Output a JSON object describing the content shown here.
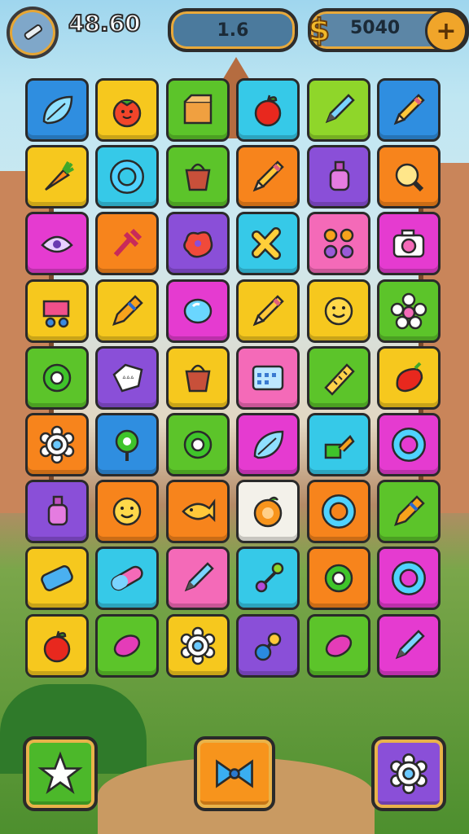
{
  "hud": {
    "score": "48.60",
    "level": "1.6",
    "coins": "5040",
    "coin_symbol": "$",
    "plus_label": "+"
  },
  "colors": {
    "blue": "#2f8ee0",
    "yellow": "#f6c81e",
    "green": "#5cc42a",
    "cyan": "#36c9e8",
    "lime": "#8fd62a",
    "orange": "#f7841c",
    "purple": "#8a4fd8",
    "magenta": "#e53bd0",
    "pink": "#f46ab8",
    "white": "#f3f1ea"
  },
  "board": {
    "rows": [
      [
        {
          "c": "blue",
          "i": "leaf-icon"
        },
        {
          "c": "yellow",
          "i": "tomato-icon"
        },
        {
          "c": "green",
          "i": "box-icon"
        },
        {
          "c": "cyan",
          "i": "apple-icon"
        },
        {
          "c": "lime",
          "i": "pen-icon"
        },
        {
          "c": "blue",
          "i": "pencil-icon"
        }
      ],
      [
        {
          "c": "yellow",
          "i": "carrot-icon"
        },
        {
          "c": "cyan",
          "i": "ring-icon"
        },
        {
          "c": "green",
          "i": "bag-icon"
        },
        {
          "c": "orange",
          "i": "pencil-icon"
        },
        {
          "c": "purple",
          "i": "bottle-icon"
        },
        {
          "c": "orange",
          "i": "magnifier-icon"
        }
      ],
      [
        {
          "c": "magenta",
          "i": "eye-icon"
        },
        {
          "c": "orange",
          "i": "tool-icon"
        },
        {
          "c": "purple",
          "i": "blob-icon"
        },
        {
          "c": "cyan",
          "i": "cross-icon"
        },
        {
          "c": "pink",
          "i": "scissors-icon"
        },
        {
          "c": "magenta",
          "i": "camera-icon"
        }
      ],
      [
        {
          "c": "yellow",
          "i": "cart-icon"
        },
        {
          "c": "yellow",
          "i": "crayon-icon"
        },
        {
          "c": "magenta",
          "i": "balloon-icon"
        },
        {
          "c": "yellow",
          "i": "pencil-icon"
        },
        {
          "c": "yellow",
          "i": "smiley-icon"
        },
        {
          "c": "green",
          "i": "flower-icon"
        }
      ],
      [
        {
          "c": "green",
          "i": "donut-icon"
        },
        {
          "c": "purple",
          "i": "tag-icon"
        },
        {
          "c": "yellow",
          "i": "bag-icon"
        },
        {
          "c": "pink",
          "i": "calculator-icon"
        },
        {
          "c": "green",
          "i": "ruler-icon"
        },
        {
          "c": "yellow",
          "i": "pepper-icon"
        }
      ],
      [
        {
          "c": "orange",
          "i": "gear-icon"
        },
        {
          "c": "blue",
          "i": "lollipop-icon"
        },
        {
          "c": "green",
          "i": "donut-icon"
        },
        {
          "c": "magenta",
          "i": "leaf-icon"
        },
        {
          "c": "cyan",
          "i": "cup-icon"
        },
        {
          "c": "magenta",
          "i": "ring-icon"
        }
      ],
      [
        {
          "c": "purple",
          "i": "bottle-icon"
        },
        {
          "c": "orange",
          "i": "smiley-icon"
        },
        {
          "c": "orange",
          "i": "fish-icon"
        },
        {
          "c": "white",
          "i": "orange-fruit-icon"
        },
        {
          "c": "orange",
          "i": "ring-icon"
        },
        {
          "c": "green",
          "i": "crayon-icon"
        }
      ],
      [
        {
          "c": "yellow",
          "i": "eraser-icon"
        },
        {
          "c": "cyan",
          "i": "pill-icon"
        },
        {
          "c": "pink",
          "i": "pen-icon"
        },
        {
          "c": "cyan",
          "i": "rattle-icon"
        },
        {
          "c": "orange",
          "i": "donut-icon"
        },
        {
          "c": "magenta",
          "i": "ring-icon"
        }
      ],
      [
        {
          "c": "yellow",
          "i": "apple-icon"
        },
        {
          "c": "green",
          "i": "candy-icon"
        },
        {
          "c": "yellow",
          "i": "gear-icon"
        },
        {
          "c": "purple",
          "i": "pacifier-icon"
        },
        {
          "c": "green",
          "i": "candy-icon"
        },
        {
          "c": "magenta",
          "i": "pen-icon"
        }
      ]
    ]
  },
  "bottom": {
    "left": {
      "icon": "star-icon",
      "color": "#4cb82a"
    },
    "center": {
      "icon": "bow-icon",
      "color": "#f7941c"
    },
    "right": {
      "icon": "gear-icon",
      "color": "#8a4fd8"
    }
  }
}
